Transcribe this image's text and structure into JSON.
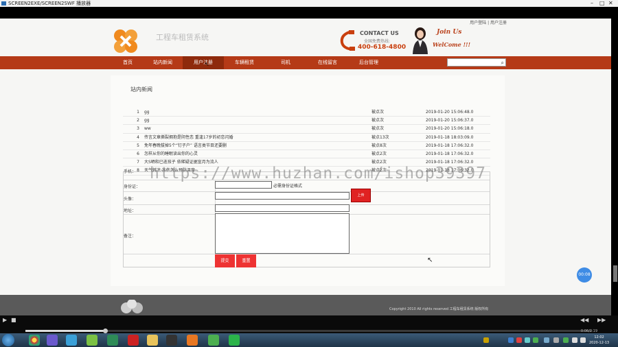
{
  "window": {
    "title": "SCREEN2EXE/SCREEN2SWF 播放器",
    "controls": [
      "–",
      "□",
      "✕"
    ]
  },
  "header": {
    "top_links": "用户登陆 | 用户注册",
    "site_title": "工程车租赁系统",
    "contact_us": "CONTACT US",
    "free_hotline": "全国免费热线:",
    "phone": "400-618-4800",
    "join_us": "Join Us",
    "welcome": "WelCome !!!"
  },
  "nav": {
    "items": [
      "首页",
      "站内新闻",
      "用户注册",
      "车辆租赁",
      "司机",
      "在线留言",
      "后台管理"
    ],
    "active_index": 2,
    "search_placeholder": ""
  },
  "news": {
    "title": "站内新闻",
    "rows": [
      {
        "num": "1",
        "title": "gg",
        "clicks": "被点次",
        "date": "2019-01-20 15:06:48.0"
      },
      {
        "num": "2",
        "title": "gg",
        "clicks": "被点次",
        "date": "2019-01-20 15:06:37.0"
      },
      {
        "num": "3",
        "title": "ww",
        "clicks": "被点次",
        "date": "2019-01-20 15:06:18.0"
      },
      {
        "num": "4",
        "title": "传言文章撕裂拥抱是阴性恋 重逢17岁的初恋闪婚",
        "clicks": "被点13次",
        "date": "2019-01-18 18:03:09.0"
      },
      {
        "num": "5",
        "title": "免年春晚拔掉5个“钉子户” 语言类节目还要删",
        "clicks": "被点8次",
        "date": "2019-01-18 17:06:32.0"
      },
      {
        "num": "6",
        "title": "怎样从你的睡眠读出你的心灵",
        "clicks": "被点2次",
        "date": "2019-01-18 17:06:32.0"
      },
      {
        "num": "7",
        "title": "大S晒和已逝孩子 依稀疑证据宣月为流人",
        "clicks": "被点2次",
        "date": "2019-01-18 17:06:32.0"
      },
      {
        "num": "8",
        "title": "天气转凉 冻伤怎么预防温度",
        "clicks": "被点2次",
        "date": "2019-01-18 17:06:32.0"
      }
    ]
  },
  "form": {
    "phone_label": "手机：",
    "idcard_label": "身份证：",
    "idcard_hint": "必需身份证格式",
    "avatar_label": "头像：",
    "upload_label": "上传",
    "address_label": "地址：",
    "remarks_label": "备注：",
    "submit_label": "提交",
    "reset_label": "重置"
  },
  "watermark": "https://www.huzhan.com/ishop39397",
  "bubble": "00:08",
  "footer": {
    "copyright": "Copyright 2010 All rights reserved 工程车租赁系统 版权所有"
  },
  "player": {
    "play": "▶",
    "stop": "■",
    "rewind": "◀◀",
    "forward": "▶▶",
    "time": "0:06/2:19",
    "progress": 0.14
  },
  "clock": {
    "time": "12:02",
    "date": "2020-12-13"
  },
  "colors": {
    "nav_bg": "#b53a17",
    "nav_active": "#8e2a0c",
    "accent": "#c9400f",
    "button_red": "#e33333"
  }
}
